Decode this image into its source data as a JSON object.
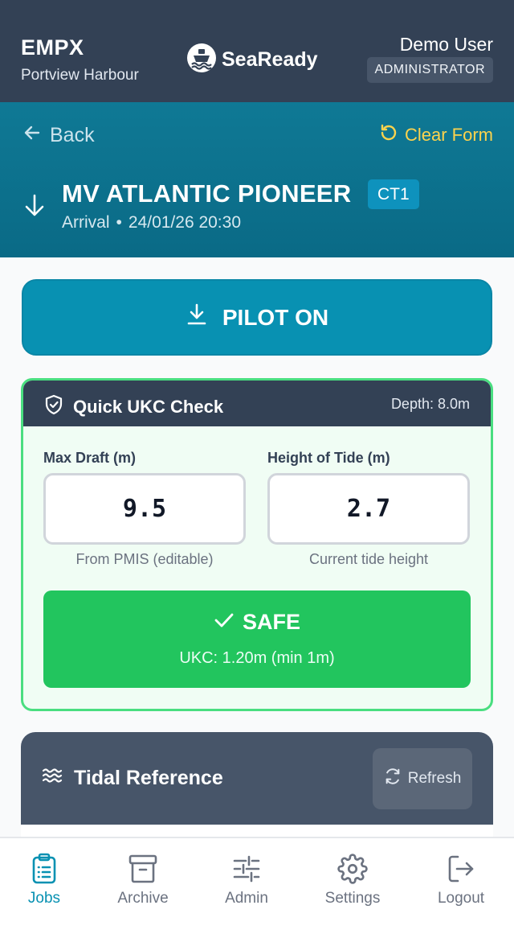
{
  "header": {
    "port_code": "EMPX",
    "port_name": "Portview Harbour",
    "brand": "SeaReady",
    "user_name": "Demo User",
    "user_role": "ADMINISTRATOR"
  },
  "job": {
    "back_label": "Back",
    "clear_label": "Clear Form",
    "direction_icon": "arrow-down-icon",
    "vessel_name": "MV ATLANTIC PIONEER",
    "berth": "CT1",
    "movement_type": "Arrival",
    "separator": "•",
    "datetime": "24/01/26 20:30"
  },
  "pilot_button": {
    "label": "PILOT ON",
    "icon": "download-icon"
  },
  "ukc_check": {
    "title": "Quick UKC Check",
    "depth": "Depth: 8.0m",
    "max_draft": {
      "label": "Max Draft (m)",
      "value": "9.5",
      "help": "From PMIS (editable)"
    },
    "tide": {
      "label": "Height of Tide (m)",
      "value": "2.7",
      "help": "Current tide height"
    },
    "result": {
      "status": "SAFE",
      "detail": "UKC: 1.20m (min 1m)",
      "color": "#22c55e"
    }
  },
  "tidal_reference": {
    "title": "Tidal Reference",
    "refresh_label": "Refresh"
  },
  "bottom_nav": {
    "items": [
      {
        "label": "Jobs",
        "icon": "clipboard-icon",
        "active": true
      },
      {
        "label": "Archive",
        "icon": "archive-icon",
        "active": false
      },
      {
        "label": "Admin",
        "icon": "sliders-icon",
        "active": false
      },
      {
        "label": "Settings",
        "icon": "gear-icon",
        "active": false
      },
      {
        "label": "Logout",
        "icon": "logout-icon",
        "active": false
      }
    ]
  },
  "colors": {
    "header_bg": "#334155",
    "job_bg": "#0f7995",
    "accent": "#0891b2",
    "clear": "#fcd34d",
    "safe": "#22c55e"
  }
}
